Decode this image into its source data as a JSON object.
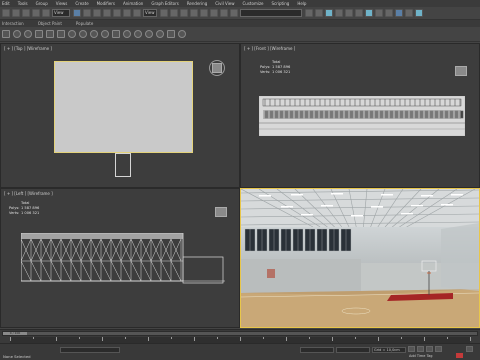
{
  "menu": [
    "Edit",
    "Tools",
    "Group",
    "Views",
    "Create",
    "Modifiers",
    "Animation",
    "Graph Editors",
    "Rendering",
    "Civil View",
    "Customize",
    "Scripting",
    "Help"
  ],
  "toolbar": {
    "view_field": "View",
    "selection_field": ""
  },
  "subbar": [
    "Interaction",
    "Object Paint",
    "Populate"
  ],
  "viewports": {
    "top": {
      "label": "[ + ] [Top ] [Wireframe ]"
    },
    "front": {
      "label": "[ + ] [Front ] [Wireframe ]"
    },
    "left": {
      "label": "[ + ] [Left ] [Wireframe ]"
    },
    "perspective": {
      "label": ""
    }
  },
  "stats": {
    "header": "Total",
    "polys_label": "Polys:",
    "polys_value": "1 587 896",
    "verts_label": "Verts:",
    "verts_value": "1 006 321"
  },
  "timeline": {
    "frame_display": "0 / 100"
  },
  "status": {
    "message": "None Selected",
    "coord_field": "Grid = 10,0cm",
    "autokey_label": "Add Time Tag"
  },
  "colors": {
    "selection_outline": "#e8c64a",
    "viewport_bg": "#3d3d3d",
    "floor": "#c9a877",
    "court_mark": "#a52525"
  }
}
